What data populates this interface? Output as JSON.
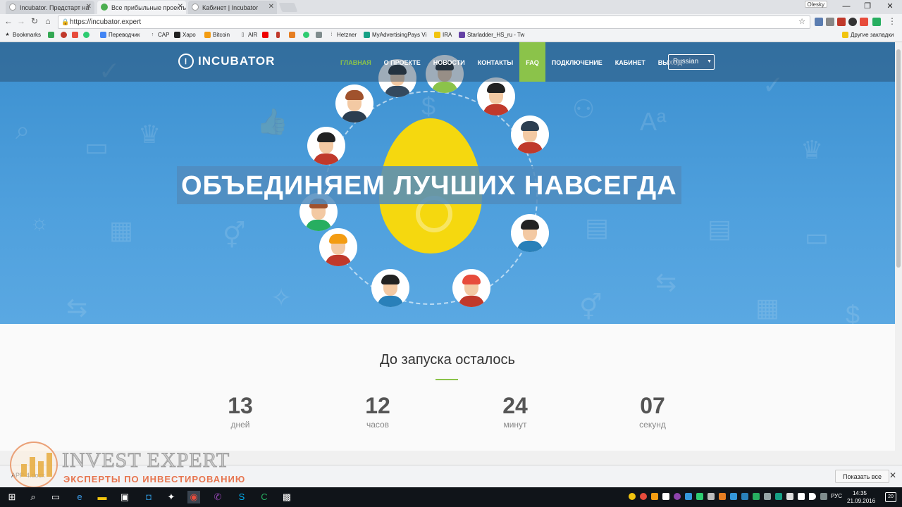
{
  "browser": {
    "tabs": [
      {
        "title": "Incubator. Предстарт на",
        "favicon": "incubator-favicon"
      },
      {
        "title": "Все прибыльные проекты",
        "favicon": "leaf-favicon"
      },
      {
        "title": "Кабинет | Incubator",
        "favicon": "incubator-favicon"
      }
    ],
    "profile": "Olesky",
    "url": "https://incubator.expert",
    "bookmarks": [
      "Bookmarks",
      "",
      "",
      "",
      "Переводчик",
      "CAP",
      "Харо",
      "Bitcoin",
      "AIR",
      "",
      "",
      "",
      "",
      "",
      "Hetzner",
      "MyAdvertisingPays Vi",
      "IRA",
      "Starladder_HS_ru - Tw"
    ],
    "other_bookmarks": "Другие закладки"
  },
  "site": {
    "logo": "INCUBATOR",
    "menu": [
      {
        "label": "ГЛАВНАЯ",
        "state": "current"
      },
      {
        "label": "О ПРОЕКТЕ",
        "state": ""
      },
      {
        "label": "НОВОСТИ",
        "state": ""
      },
      {
        "label": "КОНТАКТЫ",
        "state": ""
      },
      {
        "label": "FAQ",
        "state": "hover"
      },
      {
        "label": "ПОДКЛЮЧЕНИЕ",
        "state": ""
      },
      {
        "label": "КАБИНЕТ",
        "state": ""
      },
      {
        "label": "ВЫХОД",
        "state": ""
      }
    ],
    "language": "Russian",
    "headline": "ОБЪЕДИНЯЕМ ЛУЧШИХ НАВСЕГДА",
    "countdown": {
      "title": "До запуска осталось",
      "items": [
        {
          "value": "13",
          "label": "дней"
        },
        {
          "value": "12",
          "label": "часов"
        },
        {
          "value": "24",
          "label": "минут"
        },
        {
          "value": "07",
          "label": "секунд"
        }
      ]
    },
    "colors": {
      "accent": "#8bc34a",
      "hero": "#4fa0dd",
      "egg": "#f5d80f"
    }
  },
  "downloads": {
    "item": "APP-4.docx",
    "show_all": "Показать все"
  },
  "watermark": {
    "title": "INVEST EXPERT",
    "subtitle": "ЭКСПЕРТЫ ПО ИНВЕСТИРОВАНИЮ"
  },
  "taskbar": {
    "language": "РУС",
    "time": "14:35",
    "date": "21.09.2016",
    "notifications": "20"
  }
}
